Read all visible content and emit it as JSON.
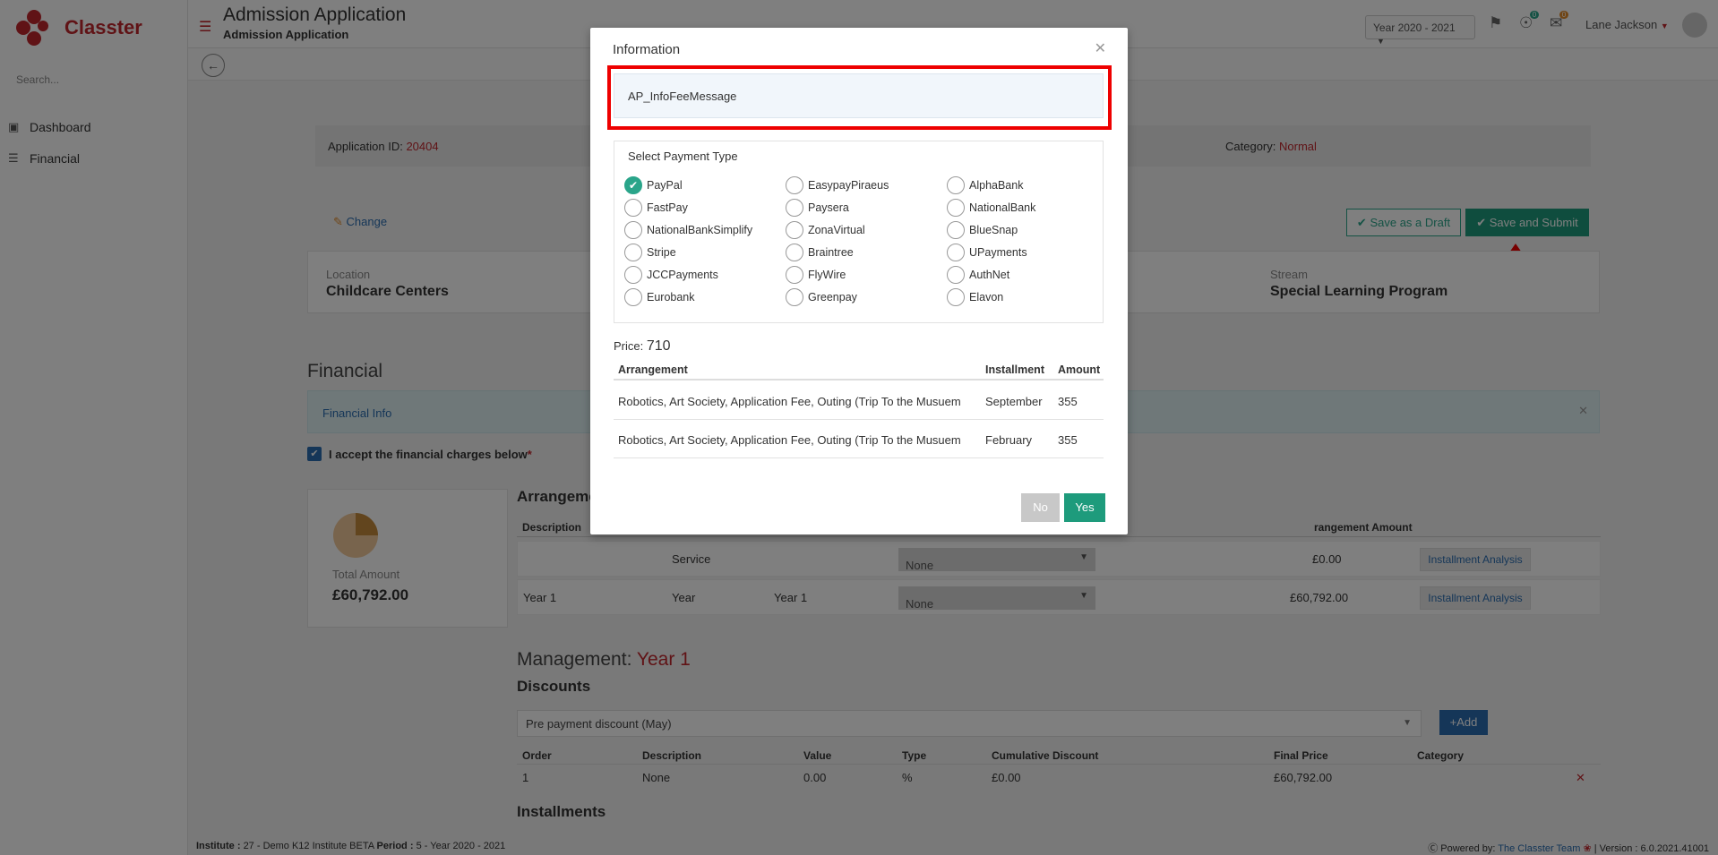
{
  "brand": {
    "name": "Classter"
  },
  "sidebar": {
    "search_placeholder": "Search...",
    "items": [
      {
        "label": "Dashboard",
        "icon": "laptop-icon"
      },
      {
        "label": "Financial",
        "icon": "database-icon"
      }
    ]
  },
  "header": {
    "title": "Admission Application",
    "subtitle": "Admission Application",
    "year": "Year 2020 - 2021",
    "notifications_count": "0",
    "messages_count": "0",
    "user_name": "Lane Jackson"
  },
  "application": {
    "id_label": "Application ID:",
    "id_value": "20404",
    "category_label": "Category:",
    "category_value": "Normal",
    "change_label": "Change",
    "save_draft_label": "Save as a Draft",
    "save_submit_label": "Save and Submit",
    "location_label": "Location",
    "location_value": "Childcare Centers",
    "stream_label": "Stream",
    "stream_value": "Special Learning Program"
  },
  "financial": {
    "section_title": "Financial",
    "info_label": "Financial Info",
    "accept_label": "I accept the financial charges below",
    "required_mark": "*",
    "total_label": "Total Amount",
    "total_value": "£60,792.00",
    "arrangements_title": "Arrangeme",
    "arr_headers": {
      "description": "Description",
      "amount": "rangement Amount"
    },
    "arr_rows": [
      {
        "description": "",
        "type": "Service",
        "period": "",
        "select": "None",
        "amount": "£0.00",
        "button": "Installment Analysis"
      },
      {
        "description": "Year 1",
        "type": "Year",
        "period": "Year 1",
        "select": "None",
        "amount": "£60,792.00",
        "button": "Installment Analysis"
      }
    ],
    "management_label": "Management:",
    "management_year": "Year 1",
    "discounts_title": "Discounts",
    "discount_select": "Pre payment discount (May)",
    "add_label": "Add",
    "disc_headers": [
      "Order",
      "Description",
      "Value",
      "Type",
      "Cumulative Discount",
      "Final Price",
      "Category"
    ],
    "disc_row": [
      "1",
      "None",
      "0.00",
      "%",
      "£0.00",
      "£60,792.00",
      ""
    ],
    "installments_title": "Installments"
  },
  "footer": {
    "institute_label": "Institute :",
    "institute_value": "27 - Demo K12 Institute BETA",
    "period_label": "Period :",
    "period_value": "5 - Year 2020 - 2021",
    "powered_label": "Powered by:",
    "powered_value": "The Classter Team",
    "version": "| Version : 6.0.2021.41001"
  },
  "modal": {
    "title": "Information",
    "message": "AP_InfoFeeMessage",
    "payment_title": "Select Payment Type",
    "payment_options": [
      "PayPal",
      "EasypayPiraeus",
      "AlphaBank",
      "FastPay",
      "Paysera",
      "NationalBank",
      "NationalBankSimplify",
      "ZonaVirtual",
      "BlueSnap",
      "Stripe",
      "Braintree",
      "UPayments",
      "JCCPayments",
      "FlyWire",
      "AuthNet",
      "Eurobank",
      "Greenpay",
      "Elavon"
    ],
    "selected_option": "PayPal",
    "price_label": "Price:",
    "price_value": "710",
    "table_headers": {
      "arrangement": "Arrangement",
      "installment": "Installment",
      "amount": "Amount"
    },
    "table_rows": [
      {
        "arrangement": "Robotics, Art Society, Application Fee, Outing (Trip To the Musuem",
        "installment": "September",
        "amount": "355"
      },
      {
        "arrangement": "Robotics, Art Society, Application Fee, Outing (Trip To the Musuem",
        "installment": "February",
        "amount": "355"
      }
    ],
    "no_label": "No",
    "yes_label": "Yes"
  },
  "colors": {
    "brand_red": "#c0262d",
    "accent_green": "#1e9b7c",
    "highlight": "#e00000"
  }
}
